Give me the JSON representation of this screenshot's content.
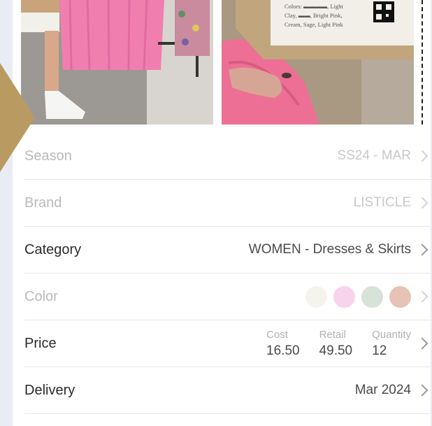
{
  "photos": {
    "tag_text": [
      "Colors: ▬▬▬▬, Light",
      "Clay, ▬▬, Bright Pink,",
      "Cream, Sage, Light Pink"
    ]
  },
  "rows": {
    "season": {
      "label": "Season",
      "value": "SS24 - MAR"
    },
    "brand": {
      "label": "Brand",
      "value": "LISTICLE"
    },
    "category": {
      "label": "Category",
      "value": "WOMEN - Dresses & Skirts"
    },
    "color": {
      "label": "Color",
      "swatches": [
        "#f4f3ee",
        "#f8d3ec",
        "#d7e2d8",
        "#e6c3b4"
      ]
    },
    "price": {
      "label": "Price",
      "cost_label": "Cost",
      "cost": "16.50",
      "retail_label": "Retail",
      "retail": "49.50",
      "quantity_label": "Quantity",
      "quantity": "12"
    },
    "delivery": {
      "label": "Delivery",
      "value": "Mar 2024"
    }
  },
  "colors": {
    "accent_arrow": "#b99b62"
  }
}
